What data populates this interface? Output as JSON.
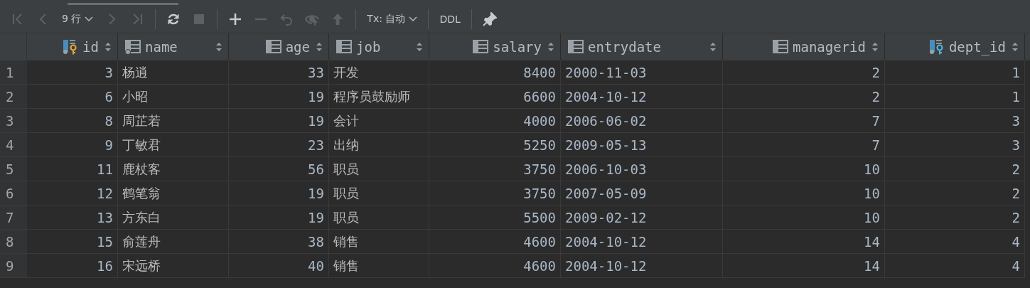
{
  "toolbar": [
    {
      "kind": "first",
      "disabled": true
    },
    {
      "kind": "prev",
      "disabled": true
    },
    {
      "kind": "dropdown",
      "label": "9 行",
      "disabled": false
    },
    {
      "kind": "next",
      "disabled": true
    },
    {
      "kind": "last",
      "disabled": true
    },
    {
      "kind": "sep"
    },
    {
      "kind": "refresh",
      "disabled": false
    },
    {
      "kind": "stop",
      "disabled": true
    },
    {
      "kind": "sep"
    },
    {
      "kind": "add",
      "disabled": false
    },
    {
      "kind": "remove",
      "disabled": true
    },
    {
      "kind": "revert",
      "disabled": true
    },
    {
      "kind": "view",
      "disabled": true
    },
    {
      "kind": "submit",
      "disabled": true
    },
    {
      "kind": "sep"
    },
    {
      "kind": "dropdown",
      "label": "Tx: 自动",
      "disabled": false
    },
    {
      "kind": "sep"
    },
    {
      "kind": "text",
      "label": "DDL",
      "disabled": false
    },
    {
      "kind": "sep"
    },
    {
      "kind": "pin",
      "disabled": false
    }
  ],
  "table": {
    "columns": [
      {
        "name": "id",
        "kind": "primary-key"
      },
      {
        "name": "name",
        "kind": "indexed"
      },
      {
        "name": "age",
        "kind": "plain"
      },
      {
        "name": "job",
        "kind": "plain"
      },
      {
        "name": "salary",
        "kind": "plain"
      },
      {
        "name": "entrydate",
        "kind": "plain"
      },
      {
        "name": "managerid",
        "kind": "plain"
      },
      {
        "name": "dept_id",
        "kind": "foreign-key"
      }
    ],
    "rows": [
      {
        "number": "1",
        "cells": [
          "3",
          "杨逍",
          "33",
          "开发",
          "8400",
          "2000-11-03",
          "2",
          "1"
        ]
      },
      {
        "number": "2",
        "cells": [
          "6",
          "小昭",
          "19",
          "程序员鼓励师",
          "6600",
          "2004-10-12",
          "2",
          "1"
        ]
      },
      {
        "number": "3",
        "cells": [
          "8",
          "周芷若",
          "19",
          "会计",
          "4000",
          "2006-06-02",
          "7",
          "3"
        ]
      },
      {
        "number": "4",
        "cells": [
          "9",
          "丁敏君",
          "23",
          "出纳",
          "5250",
          "2009-05-13",
          "7",
          "3"
        ]
      },
      {
        "number": "5",
        "cells": [
          "11",
          "鹿杖客",
          "56",
          "职员",
          "3750",
          "2006-10-03",
          "10",
          "2"
        ]
      },
      {
        "number": "6",
        "cells": [
          "12",
          "鹤笔翁",
          "19",
          "职员",
          "3750",
          "2007-05-09",
          "10",
          "2"
        ]
      },
      {
        "number": "7",
        "cells": [
          "13",
          "方东白",
          "19",
          "职员",
          "5500",
          "2009-02-12",
          "10",
          "2"
        ]
      },
      {
        "number": "8",
        "cells": [
          "15",
          "俞莲舟",
          "38",
          "销售",
          "4600",
          "2004-10-12",
          "14",
          "4"
        ]
      },
      {
        "number": "9",
        "cells": [
          "16",
          "宋远桥",
          "40",
          "销售",
          "4600",
          "2004-10-12",
          "14",
          "4"
        ]
      }
    ]
  }
}
